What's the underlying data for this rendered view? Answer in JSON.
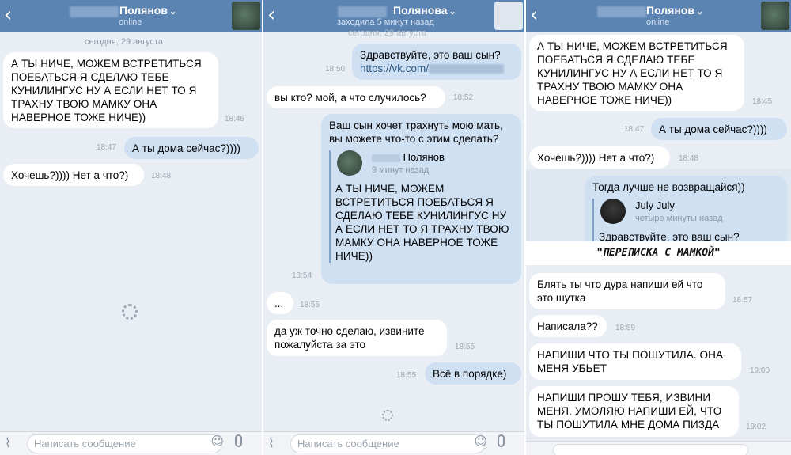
{
  "composer": {
    "placeholder": "Написать сообщение"
  },
  "caption": "\"ПЕРЕПИСКА С МАМКОЙ\"",
  "panel1": {
    "contact_name": "Полянов",
    "status": "online",
    "date_separator": "сегодня, 29 августа",
    "messages": [
      {
        "direction": "in",
        "text": "А ТЫ НИЧЕ, МОЖЕМ ВСТРЕТИТЬСЯ ПОЕБАТЬСЯ Я СДЕЛАЮ ТЕБЕ КУНИЛИНГУС НУ А ЕСЛИ НЕТ ТО Я ТРАХНУ ТВОЮ МАМКУ ОНА НАВЕРНОЕ ТОЖЕ НИЧЕ))",
        "time": "18:45"
      },
      {
        "direction": "out",
        "text": "А ты дома сейчас?))))",
        "time": "18:47"
      },
      {
        "direction": "in",
        "text": "Хочешь?)))) Нет а что?)",
        "time": "18:48"
      }
    ]
  },
  "panel2": {
    "contact_name": "Полянова",
    "status": "заходила 5 минут назад",
    "date_separator": "сегодня, 29 августа",
    "messages": [
      {
        "direction": "out",
        "text": "Здравствуйте, это ваш сын?",
        "link": "https://vk.com/",
        "time": "18:50"
      },
      {
        "direction": "in",
        "text": "вы кто? мой, а что случилось?",
        "time": "18:52"
      },
      {
        "direction": "out",
        "text": "Ваш сын хочет трахнуть мою мать, вы можете что-то с этим сделать?",
        "quote_name": "Полянов",
        "quote_time": "9 минут назад",
        "quote_text": "А ТЫ НИЧЕ, МОЖЕМ ВСТРЕТИТЬСЯ ПОЕБАТЬСЯ Я СДЕЛАЮ ТЕБЕ КУНИЛИНГУС НУ А ЕСЛИ НЕТ ТО Я ТРАХНУ ТВОЮ МАМКУ ОНА НАВЕРНОЕ ТОЖЕ НИЧЕ))",
        "time": "18:54"
      },
      {
        "direction": "in",
        "text": "...",
        "time": "18:55"
      },
      {
        "direction": "in",
        "text": "да уж точно сделаю, извините пожалуйста за это",
        "time": "18:55"
      },
      {
        "direction": "out",
        "text": "Всё в порядке)",
        "time": "18:55"
      }
    ]
  },
  "panel3": {
    "contact_name": "Полянов",
    "status": "online",
    "messages": [
      {
        "direction": "in",
        "text": "А ТЫ НИЧЕ, МОЖЕМ ВСТРЕТИТЬСЯ ПОЕБАТЬСЯ Я СДЕЛАЮ ТЕБЕ КУНИЛИНГУС НУ А ЕСЛИ НЕТ ТО Я ТРАХНУ ТВОЮ МАМКУ ОНА НАВЕРНОЕ ТОЖЕ НИЧЕ))",
        "time": "18:45"
      },
      {
        "direction": "out",
        "text": "А ты дома сейчас?))))",
        "time": "18:47"
      },
      {
        "direction": "in",
        "text": "Хочешь?)))) Нет а что?)",
        "time": "18:48"
      },
      {
        "direction": "out",
        "text": "Тогда лучше не возвращайся))",
        "quote_name": "July July",
        "quote_time": "четыре минуты назад",
        "quote_text": "Здравствуйте, это ваш сын?"
      },
      {
        "direction": "in",
        "text": "Блять ты что дура напиши ей что это шутка",
        "time": "18:57"
      },
      {
        "direction": "in",
        "text": "Написала??",
        "time": "18:59"
      },
      {
        "direction": "in",
        "text": "НАПИШИ ЧТО ТЫ ПОШУТИЛА. ОНА МЕНЯ УБЬЕТ",
        "time": "19:00"
      },
      {
        "direction": "in",
        "text": "НАПИШИ ПРОШУ ТЕБЯ, ИЗВИНИ МЕНЯ. УМОЛЯЮ НАПИШИ ЕЙ, ЧТО ТЫ ПОШУТИЛА МНЕ ДОМА ПИЗДА",
        "time": "19:02"
      }
    ]
  }
}
